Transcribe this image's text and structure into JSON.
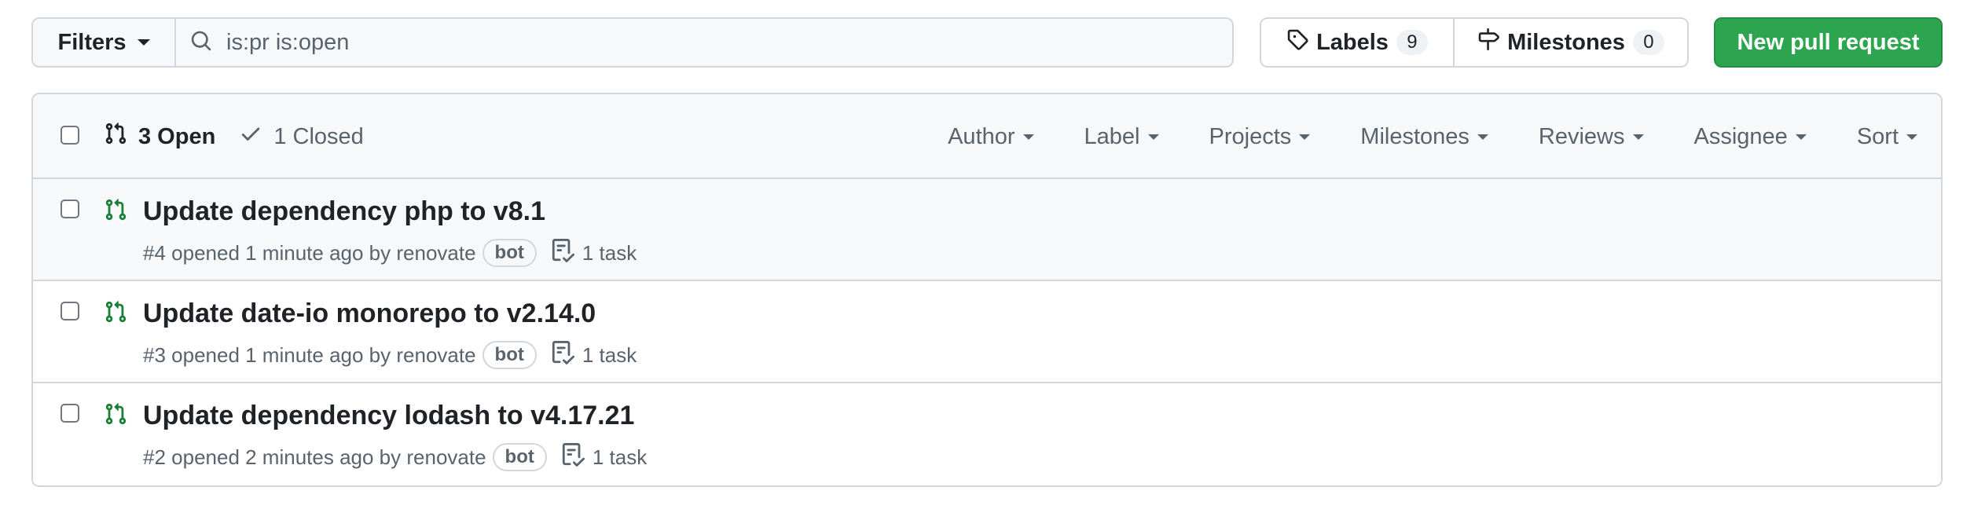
{
  "toolbar": {
    "filters_label": "Filters",
    "search_value": "is:pr is:open",
    "labels_label": "Labels",
    "labels_count": "9",
    "milestones_label": "Milestones",
    "milestones_count": "0",
    "new_pr_label": "New pull request"
  },
  "list_header": {
    "open_label": "3 Open",
    "closed_label": "1 Closed",
    "menus": [
      "Author",
      "Label",
      "Projects",
      "Milestones",
      "Reviews",
      "Assignee",
      "Sort"
    ]
  },
  "pull_requests": [
    {
      "title": "Update dependency php to v8.1",
      "meta": "#4 opened 1 minute ago by renovate",
      "label": "bot",
      "tasks": "1 task"
    },
    {
      "title": "Update date-io monorepo to v2.14.0",
      "meta": "#3 opened 1 minute ago by renovate",
      "label": "bot",
      "tasks": "1 task"
    },
    {
      "title": "Update dependency lodash to v4.17.21",
      "meta": "#2 opened 2 minutes ago by renovate",
      "label": "bot",
      "tasks": "1 task"
    }
  ],
  "colors": {
    "accent_green": "#2da44e",
    "open_icon_green": "#1a7f37",
    "border": "#d0d7de",
    "muted_text": "#59636e"
  },
  "icons": {
    "search": "search-icon",
    "tag": "tag-icon",
    "milestone": "milestone-icon",
    "pull_request": "git-pull-request-icon",
    "check": "check-icon",
    "task": "checklist-icon"
  }
}
